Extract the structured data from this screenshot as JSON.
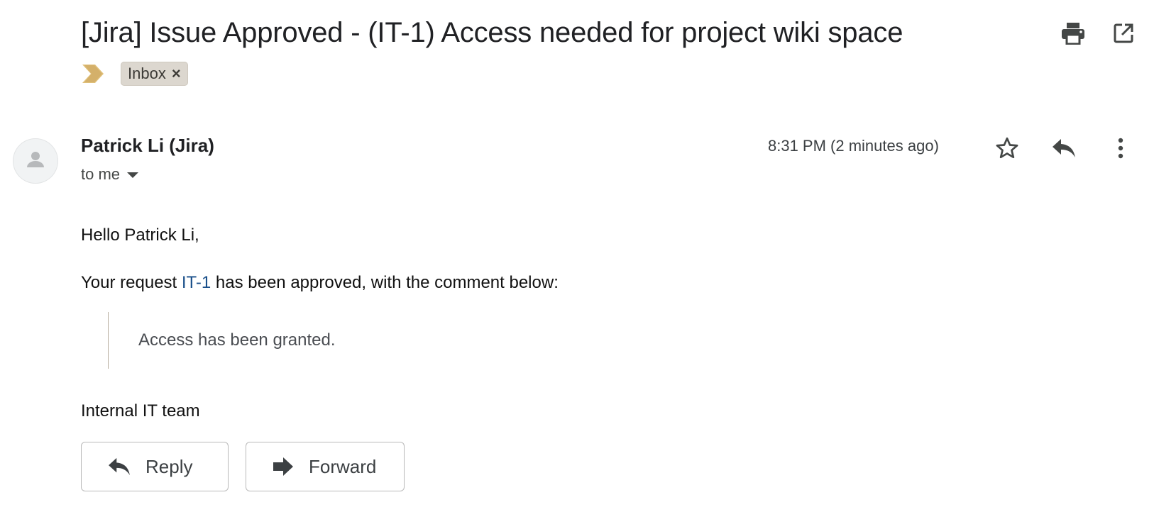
{
  "email": {
    "subject": "[Jira] Issue Approved - (IT-1) Access needed for project wiki space",
    "label": "Inbox",
    "label_close": "×",
    "sender": "Patrick Li (Jira)",
    "recipient": "to me",
    "timestamp": "8:31 PM (2 minutes ago)",
    "body": {
      "greeting": "Hello Patrick Li,",
      "intro_before": "Your request ",
      "issue_key": "IT-1",
      "intro_after": " has been approved, with the comment below:",
      "quote": "Access has been granted.",
      "signature": "Internal IT team"
    }
  },
  "actions": {
    "reply_label": "Reply",
    "forward_label": "Forward"
  },
  "icons": {
    "print": "print-icon",
    "popout": "open-in-new-window-icon",
    "importance": "importance-marker-icon",
    "star": "star-icon",
    "reply": "reply-icon",
    "more": "more-vertical-icon",
    "forward": "forward-icon"
  },
  "colors": {
    "label_chip_bg": "#dcd7cf",
    "importance_marker": "#e0c07a",
    "link": "#1a4f8a",
    "quote_border": "#b9aea0"
  }
}
